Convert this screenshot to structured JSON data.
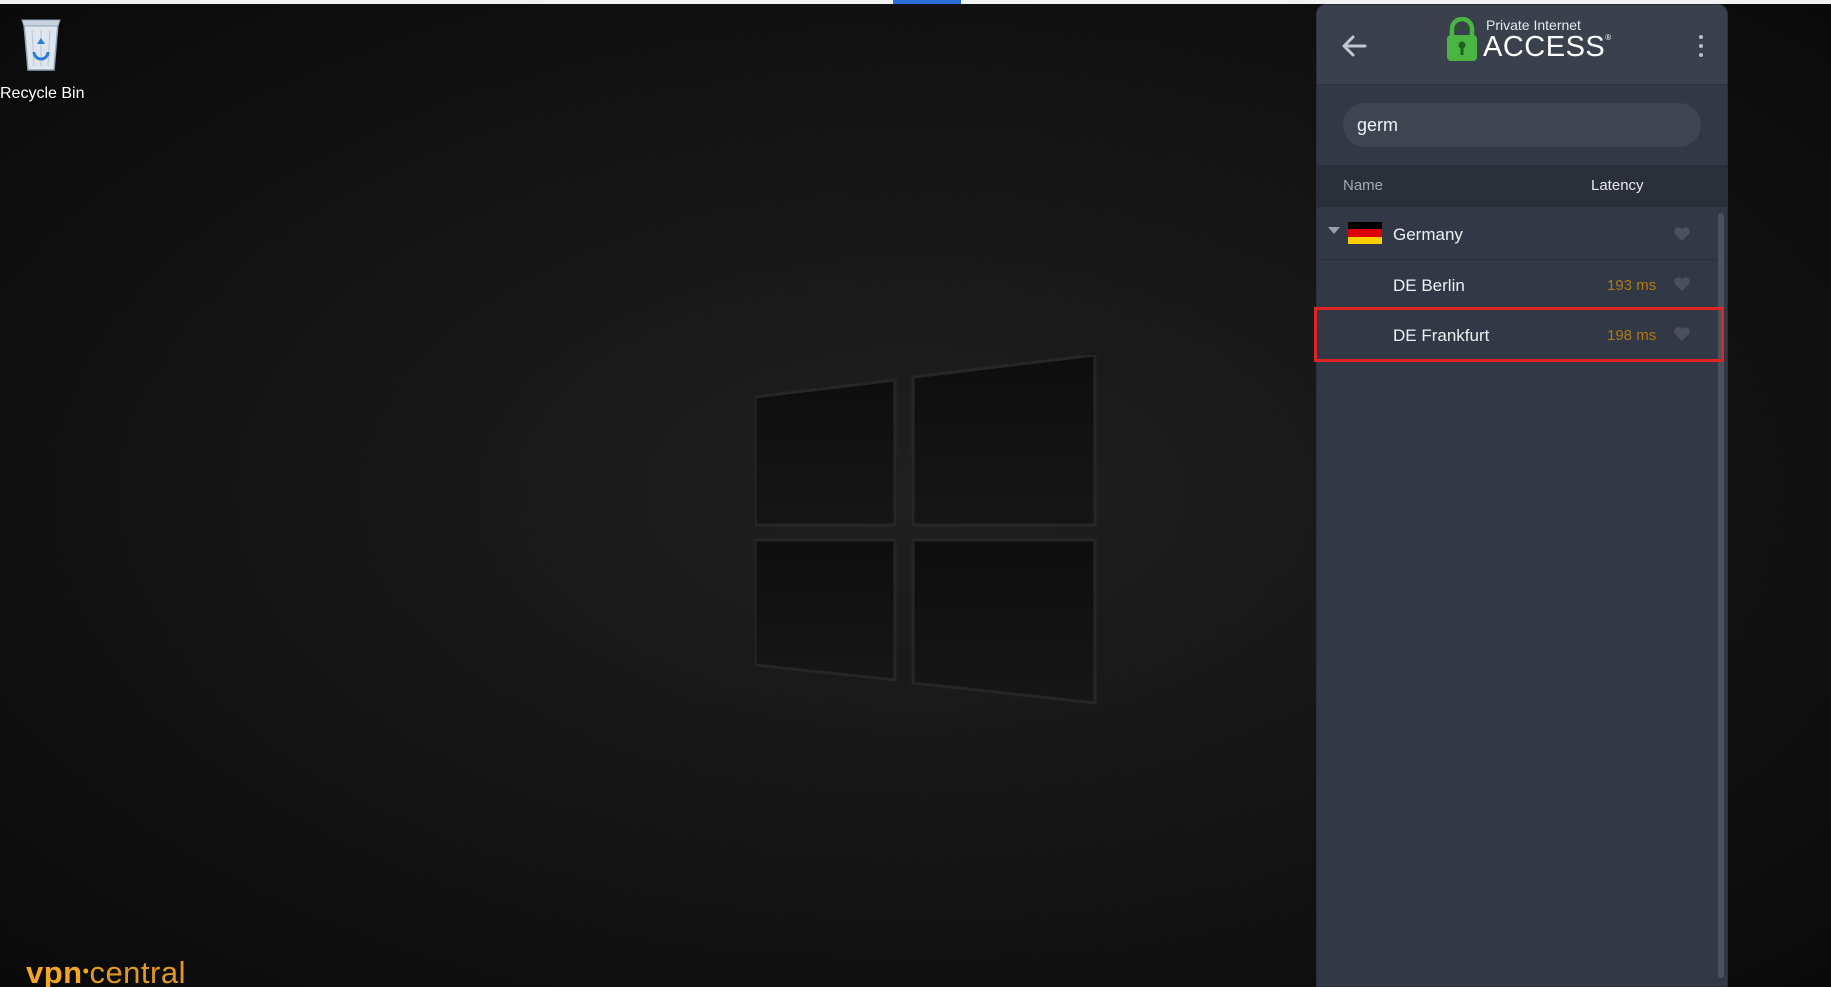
{
  "desktop": {
    "recycle_bin_label": "Recycle Bin",
    "watermark": {
      "vpn": "vpn",
      "central": "central"
    }
  },
  "pia": {
    "brand_small": "Private Internet",
    "brand_big": "ACCESS",
    "search": {
      "value": "germ",
      "placeholder": ""
    },
    "columns": {
      "name": "Name",
      "latency": "Latency"
    },
    "country": {
      "name": "Germany",
      "flag_colors": [
        "#000000",
        "#dd0000",
        "#ffce00"
      ],
      "servers": [
        {
          "name": "DE Berlin",
          "latency": "193 ms"
        },
        {
          "name": "DE Frankfurt",
          "latency": "198 ms"
        }
      ]
    },
    "colors": {
      "panel": "#323845",
      "latency_text": "#b07a12",
      "highlight_box": "#e02424",
      "brand_lock": "#4bb543"
    }
  }
}
